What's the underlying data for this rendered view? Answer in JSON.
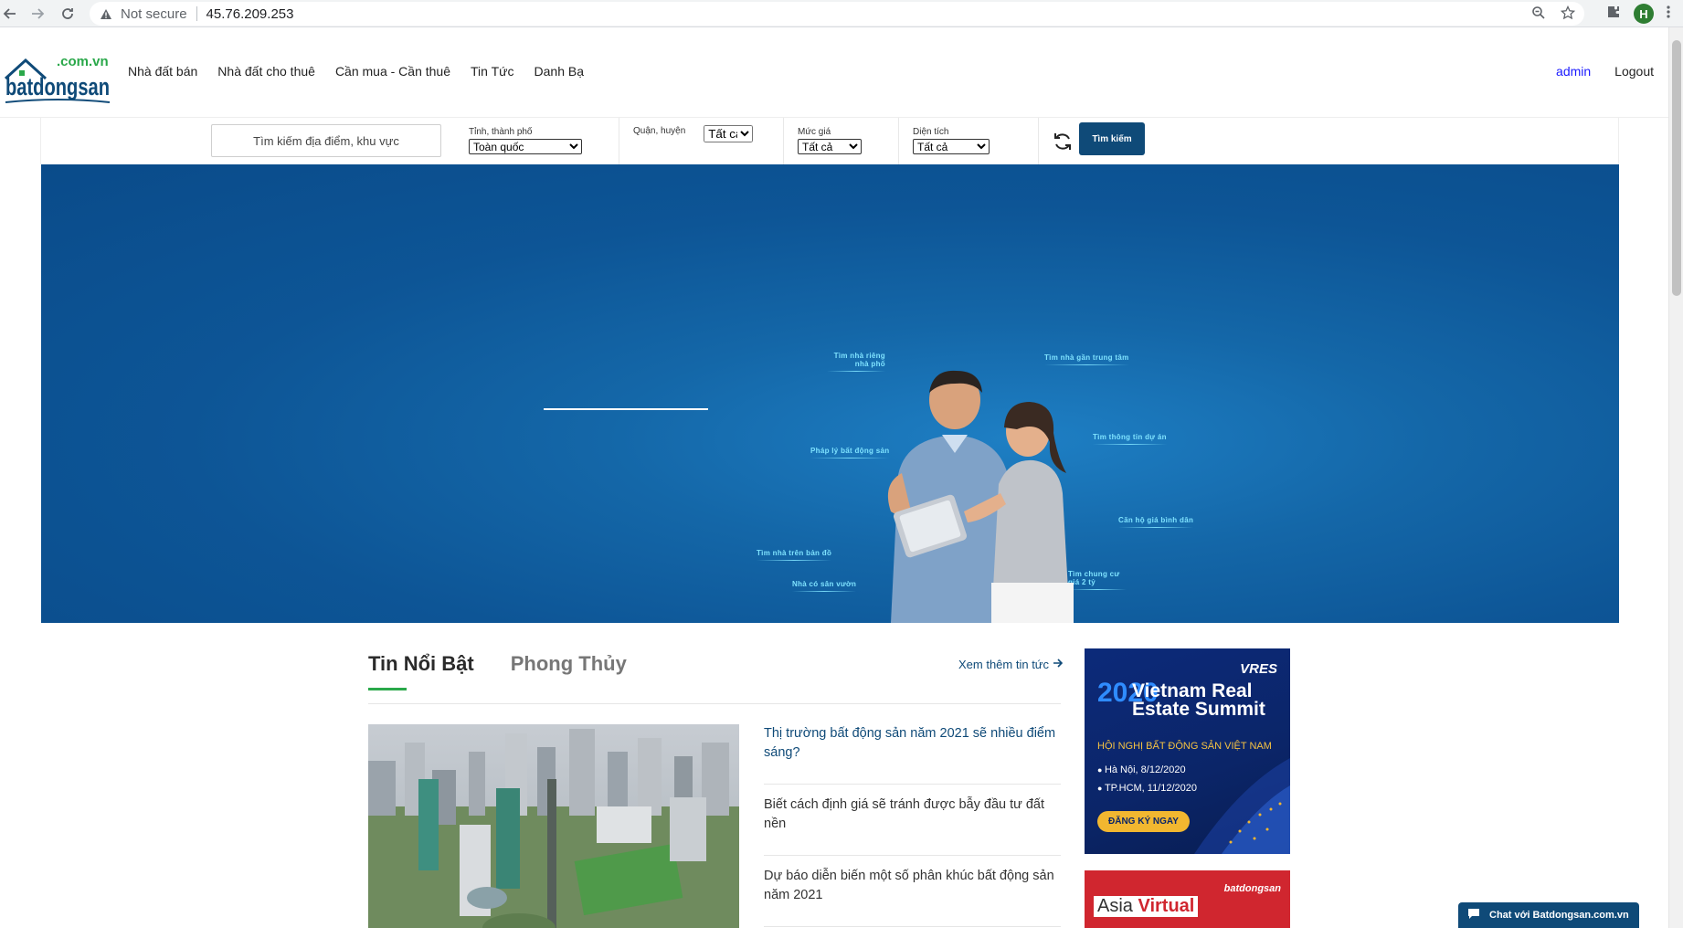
{
  "browser": {
    "security_label": "Not secure",
    "url": "45.76.209.253",
    "profile_initial": "H"
  },
  "header": {
    "logo": {
      "domain": ".com.vn",
      "wordmark": "batdongsan"
    },
    "nav": [
      "Nhà đất bán",
      "Nhà đất cho thuê",
      "Cần mua - Cần thuê",
      "Tin Tức",
      "Danh Bạ"
    ],
    "user": {
      "name": "admin",
      "logout": "Logout"
    }
  },
  "search": {
    "placeholder": "Tìm kiếm địa điểm, khu vực",
    "province": {
      "label": "Tỉnh, thành phố",
      "value": "Toàn quốc"
    },
    "district": {
      "label": "Quận, huyện",
      "value": "Tất cả"
    },
    "price": {
      "label": "Mức giá",
      "value": "Tất cả"
    },
    "area": {
      "label": "Diện tích",
      "value": "Tất cả"
    },
    "button": "Tìm kiếm"
  },
  "hero": {
    "tags": [
      "Tìm nhà riêng nhà phố",
      "Tìm nhà gần trung tâm",
      "Pháp lý bất động sản",
      "Tìm thông tin dự án",
      "Căn hộ giá bình dân",
      "Tìm nhà trên bản đồ",
      "Nhà có sân vườn",
      "Tìm chung cư giá 2 tỷ"
    ]
  },
  "news": {
    "tabs": [
      "Tin Nổi Bật",
      "Phong Thủy"
    ],
    "more_link": "Xem thêm tin tức",
    "items": [
      "Thị trường bất động sản năm 2021 sẽ nhiều điểm sáng?",
      "Biết cách định giá sẽ tránh được bẫy đầu tư đất nền",
      "Dự báo diễn biến một số phân khúc bất động sản năm 2021"
    ]
  },
  "ads": {
    "summit": {
      "brand": "VRES",
      "year": "2020",
      "title": "Vietnam Real Estate Summit",
      "subtitle": "HỘI NGHỊ BẤT ĐỘNG SẢN VIỆT NAM",
      "cities": [
        "Hà Nội, 8/12/2020",
        "TP.HCM, 11/12/2020"
      ],
      "cta": "ĐĂNG KÝ NGAY"
    },
    "expo": {
      "text_a": "Asia",
      "text_b": "Virtual",
      "brand": "batdongsan"
    }
  },
  "chat": {
    "label": "Chat với Batdongsan.com.vn"
  },
  "colors": {
    "brand_blue": "#0f4a78",
    "accent_green": "#2aa84a",
    "hero_blue": "#1467a8"
  }
}
